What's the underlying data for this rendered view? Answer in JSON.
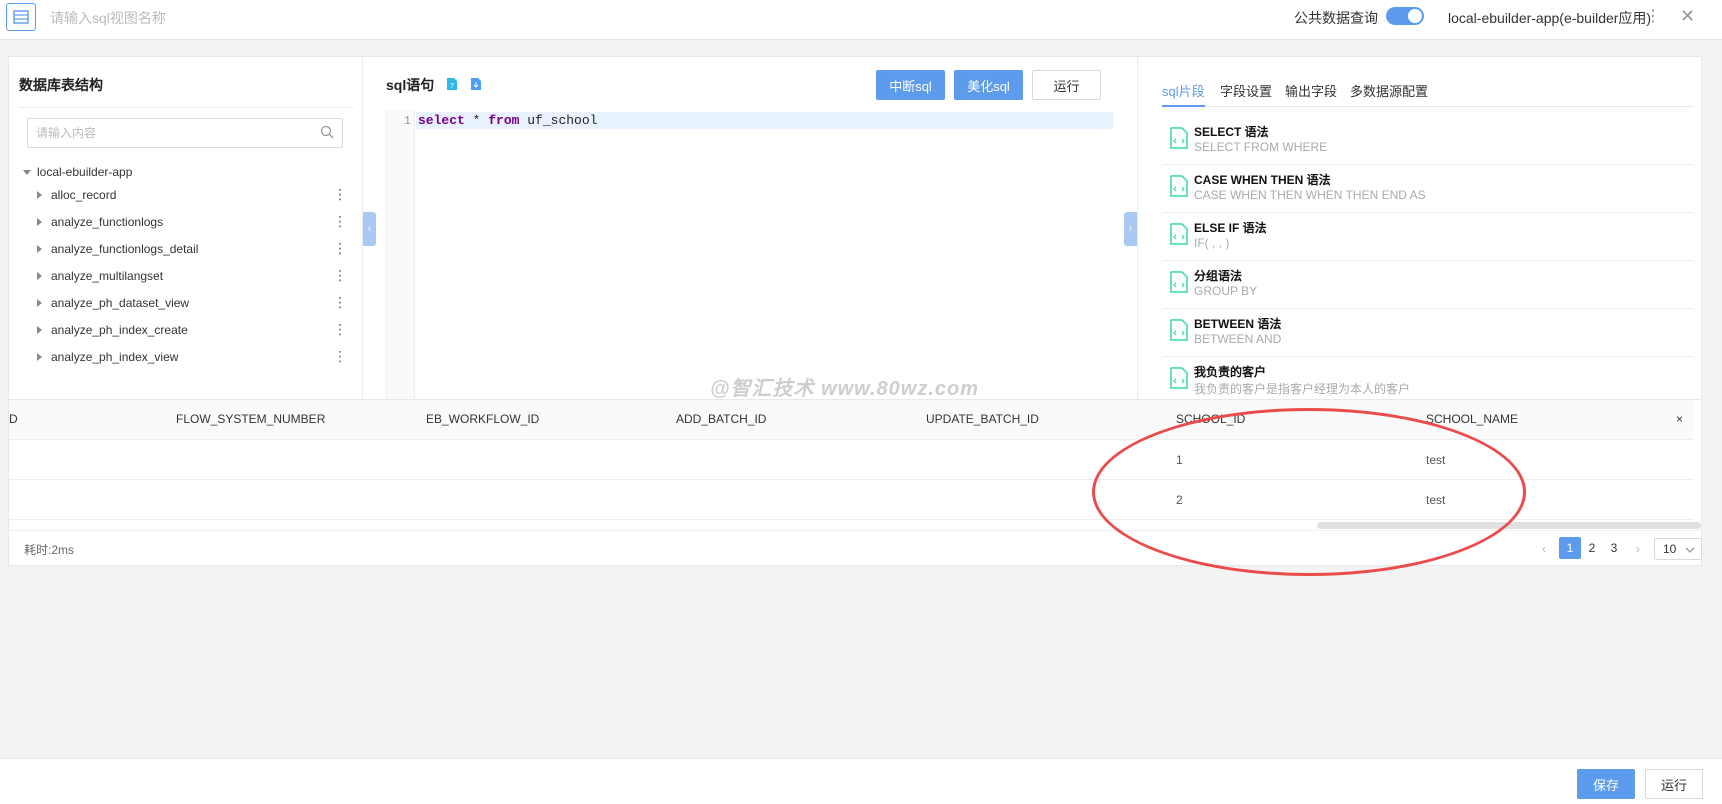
{
  "header": {
    "view_name_placeholder": "请输入sql视图名称",
    "public_query_label": "公共数据查询",
    "public_query_enabled": true,
    "app_name": "local-ebuilder-app(e-builder应用)"
  },
  "left_panel": {
    "title": "数据库表结构",
    "search_placeholder": "请输入内容",
    "root": "local-ebuilder-app",
    "items": [
      {
        "label": "alloc_record"
      },
      {
        "label": "analyze_functionlogs"
      },
      {
        "label": "analyze_functionlogs_detail"
      },
      {
        "label": "analyze_multilangset"
      },
      {
        "label": "analyze_ph_dataset_view"
      },
      {
        "label": "analyze_ph_index_create"
      },
      {
        "label": "analyze_ph_index_view"
      }
    ]
  },
  "sql_panel": {
    "title": "sql语句",
    "buttons": {
      "interrupt": "中断sql",
      "beautify": "美化sql",
      "run": "运行"
    },
    "line_number": "1",
    "code": {
      "kw1": "select",
      "star": " * ",
      "kw2": "from",
      "table": " uf_school"
    }
  },
  "right_panel": {
    "tabs": [
      "sql片段",
      "字段设置",
      "输出字段",
      "多数据源配置"
    ],
    "active_tab": 0,
    "snippets": [
      {
        "title": "SELECT 语法",
        "desc": "SELECT FROM WHERE"
      },
      {
        "title": "CASE WHEN THEN 语法",
        "desc": "CASE WHEN THEN WHEN THEN END AS"
      },
      {
        "title": "ELSE IF 语法",
        "desc": "IF( , , )"
      },
      {
        "title": "分组语法",
        "desc": "GROUP BY"
      },
      {
        "title": "BETWEEN 语法",
        "desc": "BETWEEN AND"
      },
      {
        "title": "我负责的客户",
        "desc": "我负责的客户是指客户经理为本人的客户"
      }
    ]
  },
  "watermark": "@智汇技术 www.80wz.com",
  "results": {
    "columns": [
      "D",
      "FLOW_SYSTEM_NUMBER",
      "EB_WORKFLOW_ID",
      "ADD_BATCH_ID",
      "UPDATE_BATCH_ID",
      "SCHOOL_ID",
      "SCHOOL_NAME"
    ],
    "close_label": "×",
    "rows": [
      {
        "school_id": "1",
        "school_name": "test"
      },
      {
        "school_id": "2",
        "school_name": "test"
      }
    ],
    "elapsed": "耗时:2ms",
    "pages": [
      "1",
      "2",
      "3"
    ],
    "current_page": "1",
    "page_size": "10"
  },
  "footer": {
    "save": "保存",
    "run": "运行"
  },
  "colors": {
    "accent": "#5d9cec",
    "highlight_ellipse": "#ec4b4b",
    "snippet_icon": "#38d9a9"
  }
}
